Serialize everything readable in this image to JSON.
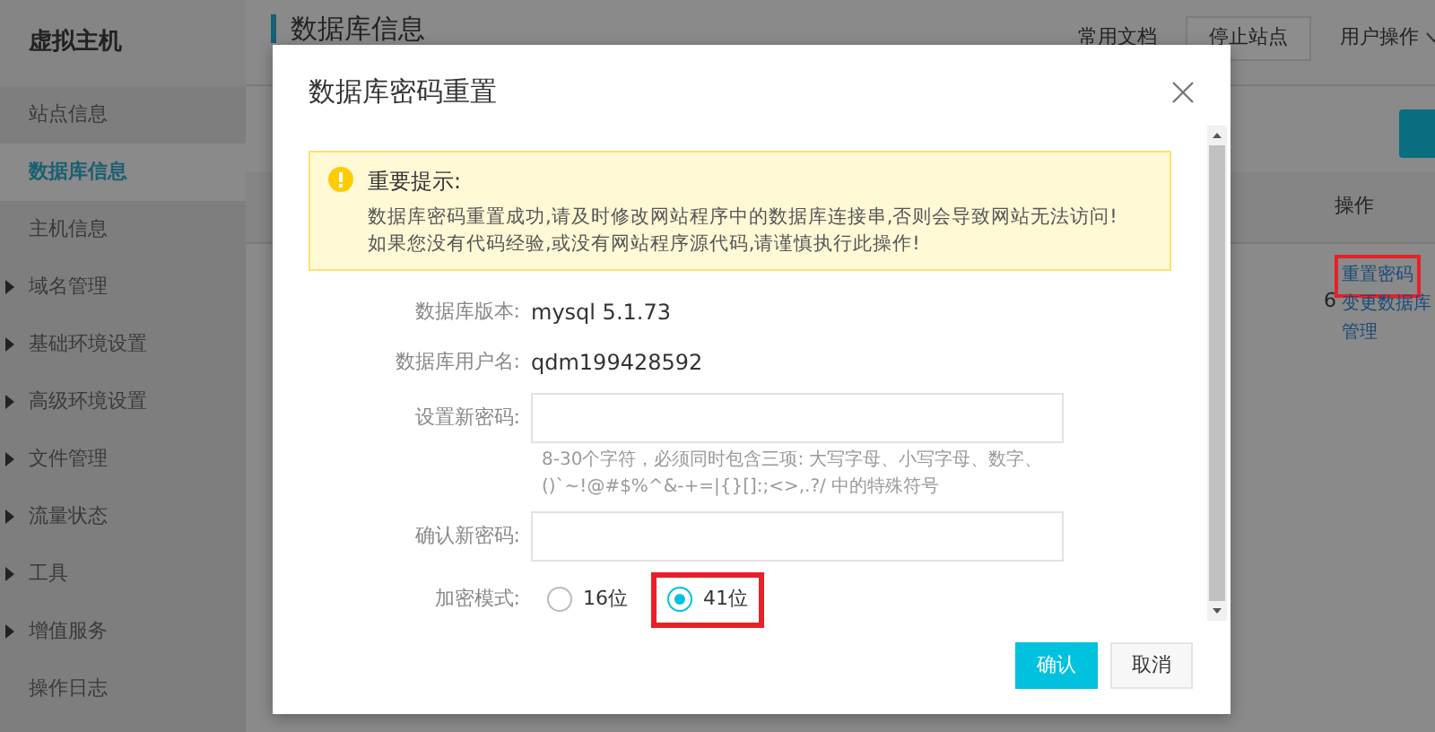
{
  "app": {
    "title": "虚拟主机"
  },
  "sidebar": {
    "items": [
      {
        "label": "站点信息",
        "selected": false,
        "expandable": false
      },
      {
        "label": "数据库信息",
        "selected": true,
        "expandable": false
      },
      {
        "label": "主机信息",
        "selected": false,
        "expandable": false
      },
      {
        "label": "域名管理",
        "selected": false,
        "expandable": true
      },
      {
        "label": "基础环境设置",
        "selected": false,
        "expandable": true
      },
      {
        "label": "高级环境设置",
        "selected": false,
        "expandable": true
      },
      {
        "label": "文件管理",
        "selected": false,
        "expandable": true
      },
      {
        "label": "流量状态",
        "selected": false,
        "expandable": true
      },
      {
        "label": "工具",
        "selected": false,
        "expandable": true
      },
      {
        "label": "增值服务",
        "selected": false,
        "expandable": true
      },
      {
        "label": "操作日志",
        "selected": false,
        "expandable": false
      }
    ]
  },
  "header": {
    "page_title": "数据库信息",
    "docs_link": "常用文档",
    "stop_button": "停止站点",
    "user_menu": "用户操作"
  },
  "table": {
    "action_header": "操作",
    "cell": "6",
    "actions": [
      {
        "label": "重置密码",
        "highlighted": true
      },
      {
        "label": "变更数据库",
        "highlighted": false
      },
      {
        "label": "管理",
        "highlighted": false
      }
    ]
  },
  "dialog": {
    "title": "数据库密码重置",
    "alert": {
      "title": "重要提示:",
      "lines": [
        "数据库密码重置成功,请及时修改网站程序中的数据库连接串,否则会导致网站无法访问!",
        "如果您没有代码经验,或没有网站程序源代码,请谨慎执行此操作!"
      ]
    },
    "fields": [
      {
        "kind": "info",
        "label": "数据库版本:",
        "value": "mysql 5.1.73"
      },
      {
        "kind": "info",
        "label": "数据库用户名:",
        "value": "qdm199428592"
      },
      {
        "kind": "password",
        "label": "设置新密码:",
        "hint": "8-30个字符，必须同时包含三项: 大写字母、小写字母、数字、()`~!@#$%^&-+=|{}[]:;<>,.?/ 中的特殊符号"
      },
      {
        "kind": "password",
        "label": "确认新密码:"
      },
      {
        "kind": "radio",
        "label": "加密模式:",
        "options": [
          {
            "label": "16位",
            "selected": false,
            "highlighted": false
          },
          {
            "label": "41位",
            "selected": true,
            "highlighted": true
          }
        ]
      }
    ],
    "buttons": [
      {
        "label": "确认",
        "kind": "primary"
      },
      {
        "label": "取消",
        "kind": "secondary"
      }
    ]
  }
}
